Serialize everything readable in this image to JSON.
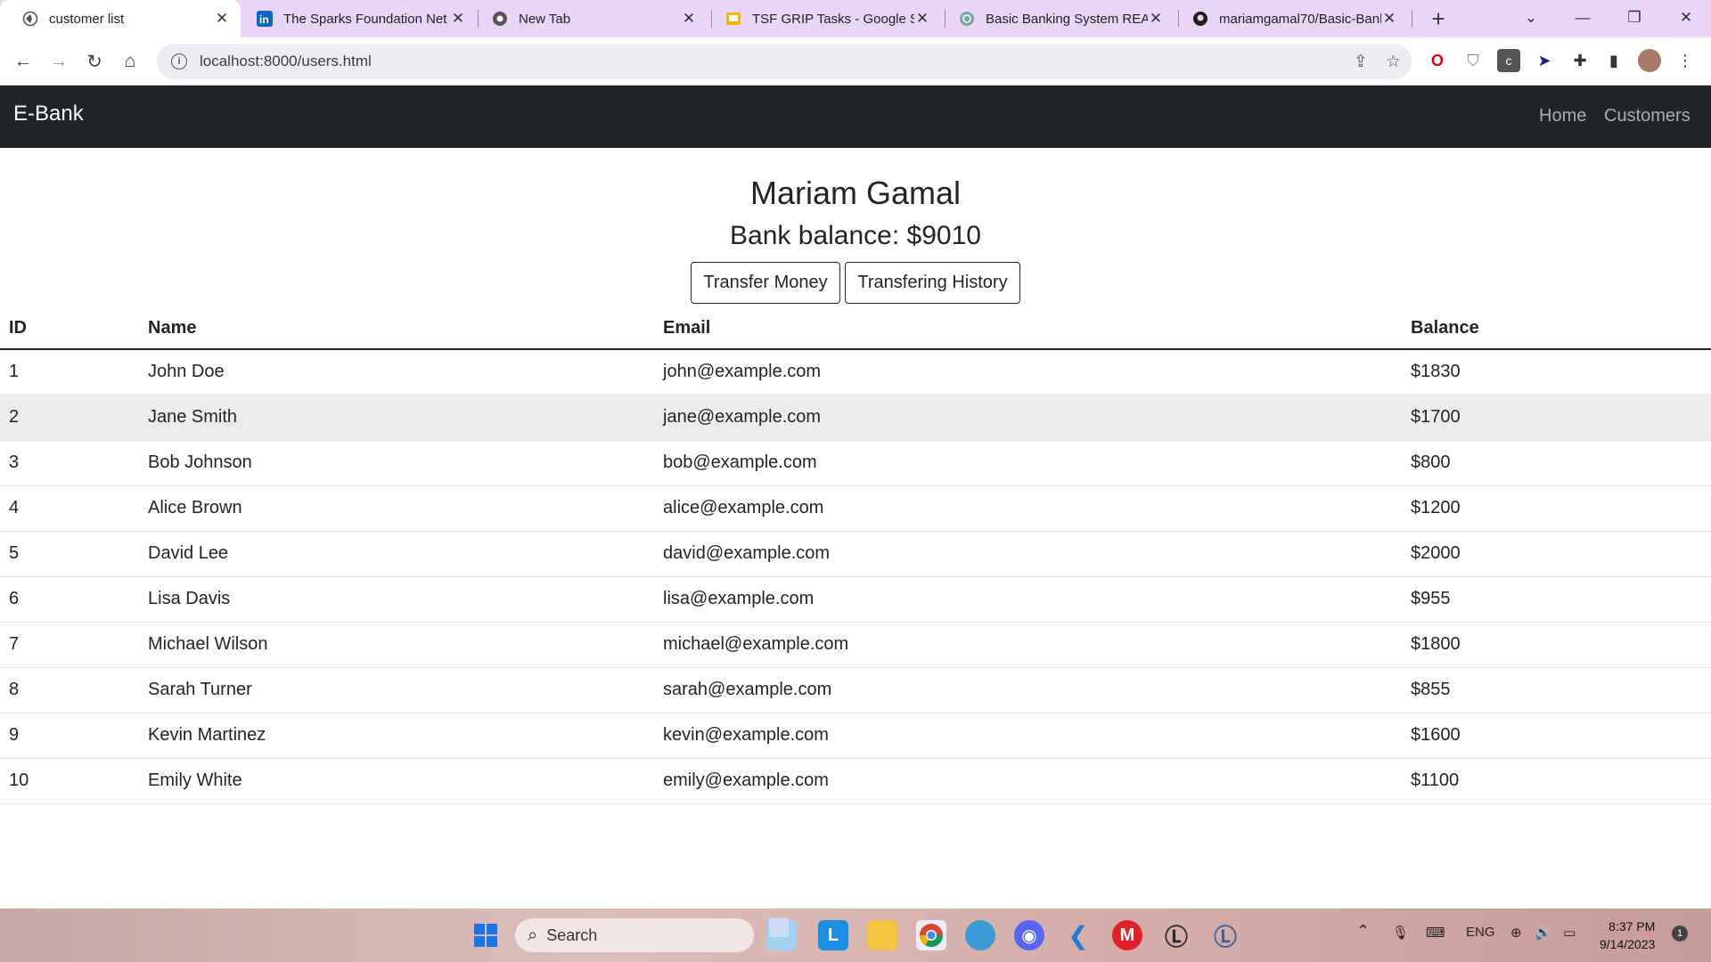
{
  "browser": {
    "tabs": [
      {
        "title": "customer list",
        "icon": "globe-icon"
      },
      {
        "title": "The Sparks Foundation Net",
        "icon": "linkedin-icon"
      },
      {
        "title": "New Tab",
        "icon": "chrome-icon"
      },
      {
        "title": "TSF GRIP Tasks - Google Sli",
        "icon": "slides-icon"
      },
      {
        "title": "Basic Banking System READ",
        "icon": "chatgpt-icon"
      },
      {
        "title": "mariamgamal70/Basic-Banl",
        "icon": "github-icon"
      }
    ],
    "address": "localhost:8000/users.html"
  },
  "navbar": {
    "brand": "E-Bank",
    "links": [
      "Home",
      "Customers"
    ]
  },
  "profile": {
    "name": "Mariam Gamal",
    "balance_text": "Bank balance: $9010",
    "transfer_label": "Transfer Money",
    "history_label": "Transfering History"
  },
  "table": {
    "headers": [
      "ID",
      "Name",
      "Email",
      "Balance"
    ],
    "rows": [
      [
        "1",
        "John Doe",
        "john@example.com",
        "$1830"
      ],
      [
        "2",
        "Jane Smith",
        "jane@example.com",
        "$1700"
      ],
      [
        "3",
        "Bob Johnson",
        "bob@example.com",
        "$800"
      ],
      [
        "4",
        "Alice Brown",
        "alice@example.com",
        "$1200"
      ],
      [
        "5",
        "David Lee",
        "david@example.com",
        "$2000"
      ],
      [
        "6",
        "Lisa Davis",
        "lisa@example.com",
        "$955"
      ],
      [
        "7",
        "Michael Wilson",
        "michael@example.com",
        "$1800"
      ],
      [
        "8",
        "Sarah Turner",
        "sarah@example.com",
        "$855"
      ],
      [
        "9",
        "Kevin Martinez",
        "kevin@example.com",
        "$1600"
      ],
      [
        "10",
        "Emily White",
        "emily@example.com",
        "$1100"
      ]
    ]
  },
  "taskbar": {
    "search_placeholder": "Search",
    "language": "ENG",
    "time": "8:37 PM",
    "date": "9/14/2023",
    "notification_count": "1"
  },
  "colors": {
    "navbar": "#212529",
    "tabstrip": "#e8d5f7",
    "striped_row": "#ececec"
  }
}
